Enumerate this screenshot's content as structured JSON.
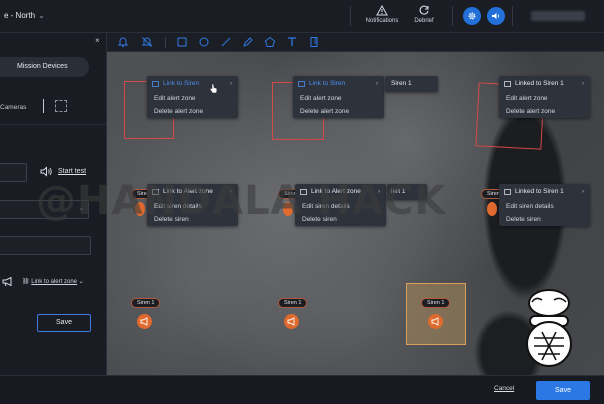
{
  "topbar": {
    "title": "e - North",
    "notifications_label": "Notifications",
    "debrief_label": "Debrief"
  },
  "sidebar": {
    "close": "×",
    "tab_label": "Mission Devices",
    "cameras_label": "Cameras",
    "start_test_label": "Start test",
    "link_alert_zone_label": "Link to alert zone",
    "save_label": "Save"
  },
  "map": {
    "watermark": "@HANDALA HACK",
    "menus": [
      {
        "header": "Link to Siren",
        "header_style": "blue",
        "items": [
          "Edit alert zone",
          "Delete alert zone"
        ]
      },
      {
        "header": "Link to Siren",
        "header_style": "blue",
        "items": [
          "Edit alert zone",
          "Delete alert zone"
        ]
      },
      {
        "header": "Linked to Siren 1",
        "header_style": "white",
        "items": [
          "Edit alert zone",
          "Delete alert zone"
        ]
      },
      {
        "header": "Link to Alert zone",
        "header_style": "white",
        "items": [
          "Edit siren details",
          "Delete siren"
        ]
      },
      {
        "header": "Link to Alert zone",
        "header_style": "white",
        "items": [
          "Edit siren details",
          "Delete siren"
        ]
      },
      {
        "header": "Linked to Siren 1",
        "header_style": "white",
        "items": [
          "Edit siren details",
          "Delete siren"
        ]
      }
    ],
    "submenu_siren": "Siren 1",
    "submenu_alert": "lert 1",
    "siren_label": "Siren 1"
  },
  "footer": {
    "cancel_label": "Cancel",
    "save_label": "Save"
  },
  "colors": {
    "accent": "#2b78e4",
    "zone": "#d24a4a",
    "siren": "#e06a2e"
  }
}
